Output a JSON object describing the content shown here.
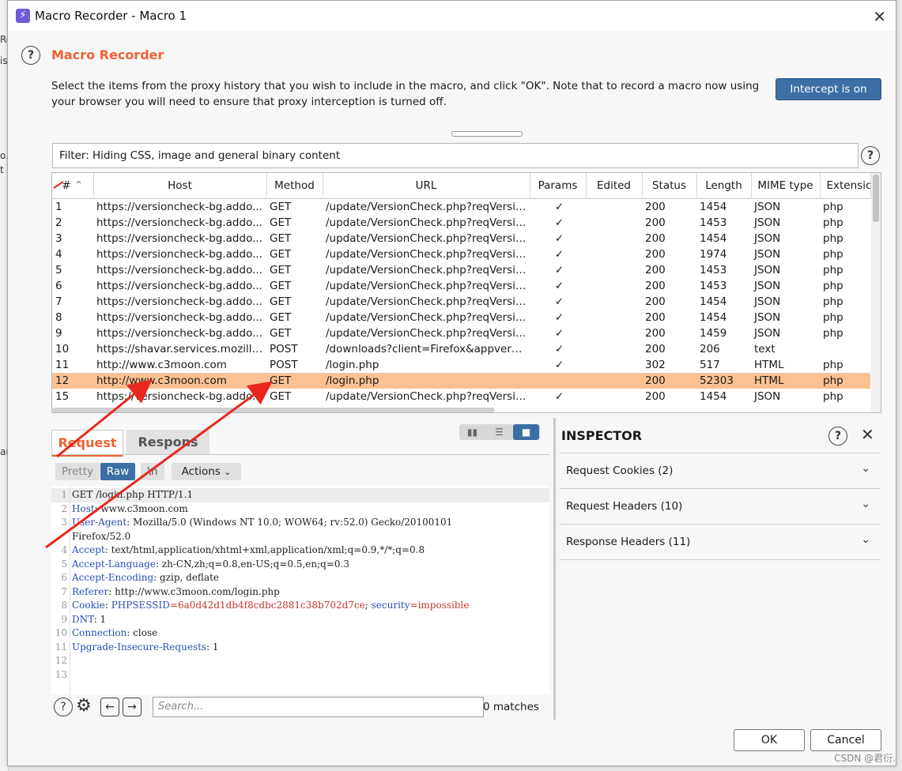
{
  "background": {
    "fragments": [
      "Ro",
      "is",
      "o.",
      "t",
      "an"
    ]
  },
  "window": {
    "title": "Macro Recorder - Macro 1",
    "icon": "lightning-icon"
  },
  "header": {
    "heading": "Macro Recorder",
    "description": "Select the items from the proxy history that you wish to include in the macro, and click \"OK\". Note that to record a macro now using your browser you will need to ensure that proxy interception is turned off.",
    "intercept_button": "Intercept is on"
  },
  "filter": {
    "text": "Filter: Hiding CSS, image and general binary content"
  },
  "table": {
    "columns": [
      "#",
      "Host",
      "Method",
      "URL",
      "Params",
      "Edited",
      "Status",
      "Length",
      "MIME type",
      "Extensic"
    ],
    "rows": [
      {
        "n": "1",
        "host": "https://versioncheck-bg.addo...",
        "method": "GET",
        "url": "/update/VersionCheck.php?reqVersio...",
        "params": "✓",
        "edited": "",
        "status": "200",
        "length": "1454",
        "mime": "JSON",
        "ext": "php"
      },
      {
        "n": "2",
        "host": "https://versioncheck-bg.addo...",
        "method": "GET",
        "url": "/update/VersionCheck.php?reqVersio...",
        "params": "✓",
        "edited": "",
        "status": "200",
        "length": "1453",
        "mime": "JSON",
        "ext": "php"
      },
      {
        "n": "3",
        "host": "https://versioncheck-bg.addo...",
        "method": "GET",
        "url": "/update/VersionCheck.php?reqVersio...",
        "params": "✓",
        "edited": "",
        "status": "200",
        "length": "1454",
        "mime": "JSON",
        "ext": "php"
      },
      {
        "n": "4",
        "host": "https://versioncheck-bg.addo...",
        "method": "GET",
        "url": "/update/VersionCheck.php?reqVersio...",
        "params": "✓",
        "edited": "",
        "status": "200",
        "length": "1974",
        "mime": "JSON",
        "ext": "php"
      },
      {
        "n": "5",
        "host": "https://versioncheck-bg.addo...",
        "method": "GET",
        "url": "/update/VersionCheck.php?reqVersio...",
        "params": "✓",
        "edited": "",
        "status": "200",
        "length": "1453",
        "mime": "JSON",
        "ext": "php"
      },
      {
        "n": "6",
        "host": "https://versioncheck-bg.addo...",
        "method": "GET",
        "url": "/update/VersionCheck.php?reqVersio...",
        "params": "✓",
        "edited": "",
        "status": "200",
        "length": "1453",
        "mime": "JSON",
        "ext": "php"
      },
      {
        "n": "7",
        "host": "https://versioncheck-bg.addo...",
        "method": "GET",
        "url": "/update/VersionCheck.php?reqVersio...",
        "params": "✓",
        "edited": "",
        "status": "200",
        "length": "1454",
        "mime": "JSON",
        "ext": "php"
      },
      {
        "n": "8",
        "host": "https://versioncheck-bg.addo...",
        "method": "GET",
        "url": "/update/VersionCheck.php?reqVersio...",
        "params": "✓",
        "edited": "",
        "status": "200",
        "length": "1454",
        "mime": "JSON",
        "ext": "php"
      },
      {
        "n": "9",
        "host": "https://versioncheck-bg.addo...",
        "method": "GET",
        "url": "/update/VersionCheck.php?reqVersio...",
        "params": "✓",
        "edited": "",
        "status": "200",
        "length": "1459",
        "mime": "JSON",
        "ext": "php"
      },
      {
        "n": "10",
        "host": "https://shavar.services.mozilla....",
        "method": "POST",
        "url": "/downloads?client=Firefox&appver=...",
        "params": "✓",
        "edited": "",
        "status": "200",
        "length": "206",
        "mime": "text",
        "ext": ""
      },
      {
        "n": "11",
        "host": "http://www.c3moon.com",
        "method": "POST",
        "url": "/login.php",
        "params": "✓",
        "edited": "",
        "status": "302",
        "length": "517",
        "mime": "HTML",
        "ext": "php"
      },
      {
        "n": "12",
        "host": "http://www.c3moon.com",
        "method": "GET",
        "url": "/login.php",
        "params": "",
        "edited": "",
        "status": "200",
        "length": "52303",
        "mime": "HTML",
        "ext": "php",
        "selected": true
      },
      {
        "n": "15",
        "host": "https://versioncheck-bg.addo...",
        "method": "GET",
        "url": "/update/VersionCheck.php?reqVersio...",
        "params": "✓",
        "edited": "",
        "status": "200",
        "length": "1454",
        "mime": "JSON",
        "ext": "php"
      }
    ]
  },
  "message_tabs": {
    "request": "Request",
    "response": "Respons"
  },
  "editor_toolbar": {
    "pretty": "Pretty",
    "raw": "Raw",
    "newline": "\\n",
    "actions": "Actions"
  },
  "request_lines": [
    {
      "n": "1",
      "parts": [
        {
          "t": "GET /login.php HTTP/1.1",
          "c": "plain"
        }
      ]
    },
    {
      "n": "2",
      "parts": [
        {
          "t": "Host",
          "c": "key"
        },
        {
          "t": ": www.c3moon.com",
          "c": "plain"
        }
      ]
    },
    {
      "n": "3",
      "parts": [
        {
          "t": "User-Agent",
          "c": "key"
        },
        {
          "t": ": Mozilla/5.0 (Windows NT 10.0; WOW64; rv:52.0) Gecko/20100101",
          "c": "plain"
        }
      ]
    },
    {
      "n": "",
      "parts": [
        {
          "t": "Firefox/52.0",
          "c": "plain"
        }
      ]
    },
    {
      "n": "4",
      "parts": [
        {
          "t": "Accept",
          "c": "key"
        },
        {
          "t": ": text/html,application/xhtml+xml,application/xml;q=0.9,*/*;q=0.8",
          "c": "plain"
        }
      ]
    },
    {
      "n": "5",
      "parts": [
        {
          "t": "Accept-Language",
          "c": "key"
        },
        {
          "t": ": zh-CN,zh;q=0.8,en-US;q=0.5,en;q=0.3",
          "c": "plain"
        }
      ]
    },
    {
      "n": "6",
      "parts": [
        {
          "t": "Accept-Encoding",
          "c": "key"
        },
        {
          "t": ": gzip, deflate",
          "c": "plain"
        }
      ]
    },
    {
      "n": "7",
      "parts": [
        {
          "t": "Referer",
          "c": "key"
        },
        {
          "t": ": http://www.c3moon.com/login.php",
          "c": "plain"
        }
      ]
    },
    {
      "n": "8",
      "parts": [
        {
          "t": "Cookie",
          "c": "key"
        },
        {
          "t": ": ",
          "c": "plain"
        },
        {
          "t": "PHPSESSID",
          "c": "key"
        },
        {
          "t": "=6a0d42d1db4f8cdbc2881c38b702d7ce",
          "c": "val"
        },
        {
          "t": "; ",
          "c": "plain"
        },
        {
          "t": "security",
          "c": "key"
        },
        {
          "t": "=impossible",
          "c": "val"
        }
      ]
    },
    {
      "n": "9",
      "parts": [
        {
          "t": "DNT",
          "c": "key"
        },
        {
          "t": ": 1",
          "c": "plain"
        }
      ]
    },
    {
      "n": "10",
      "parts": [
        {
          "t": "Connection",
          "c": "key"
        },
        {
          "t": ": close",
          "c": "plain"
        }
      ]
    },
    {
      "n": "11",
      "parts": [
        {
          "t": "Upgrade-Insecure-Requests",
          "c": "key"
        },
        {
          "t": ": 1",
          "c": "plain"
        }
      ]
    },
    {
      "n": "12",
      "parts": []
    },
    {
      "n": "13",
      "parts": []
    }
  ],
  "search": {
    "placeholder": "Search...",
    "matches": "0 matches"
  },
  "inspector": {
    "title": "INSPECTOR",
    "sections": [
      "Request Cookies (2)",
      "Request Headers (10)",
      "Response Headers (11)"
    ]
  },
  "footer": {
    "ok": "OK",
    "cancel": "Cancel"
  },
  "watermark": "CSDN @君衍.",
  "colors": {
    "accent_orange": "#ee6333",
    "selected_row": "#fbc192",
    "primary_button": "#3d6ea5",
    "annotation_arrow": "#e8281e"
  }
}
